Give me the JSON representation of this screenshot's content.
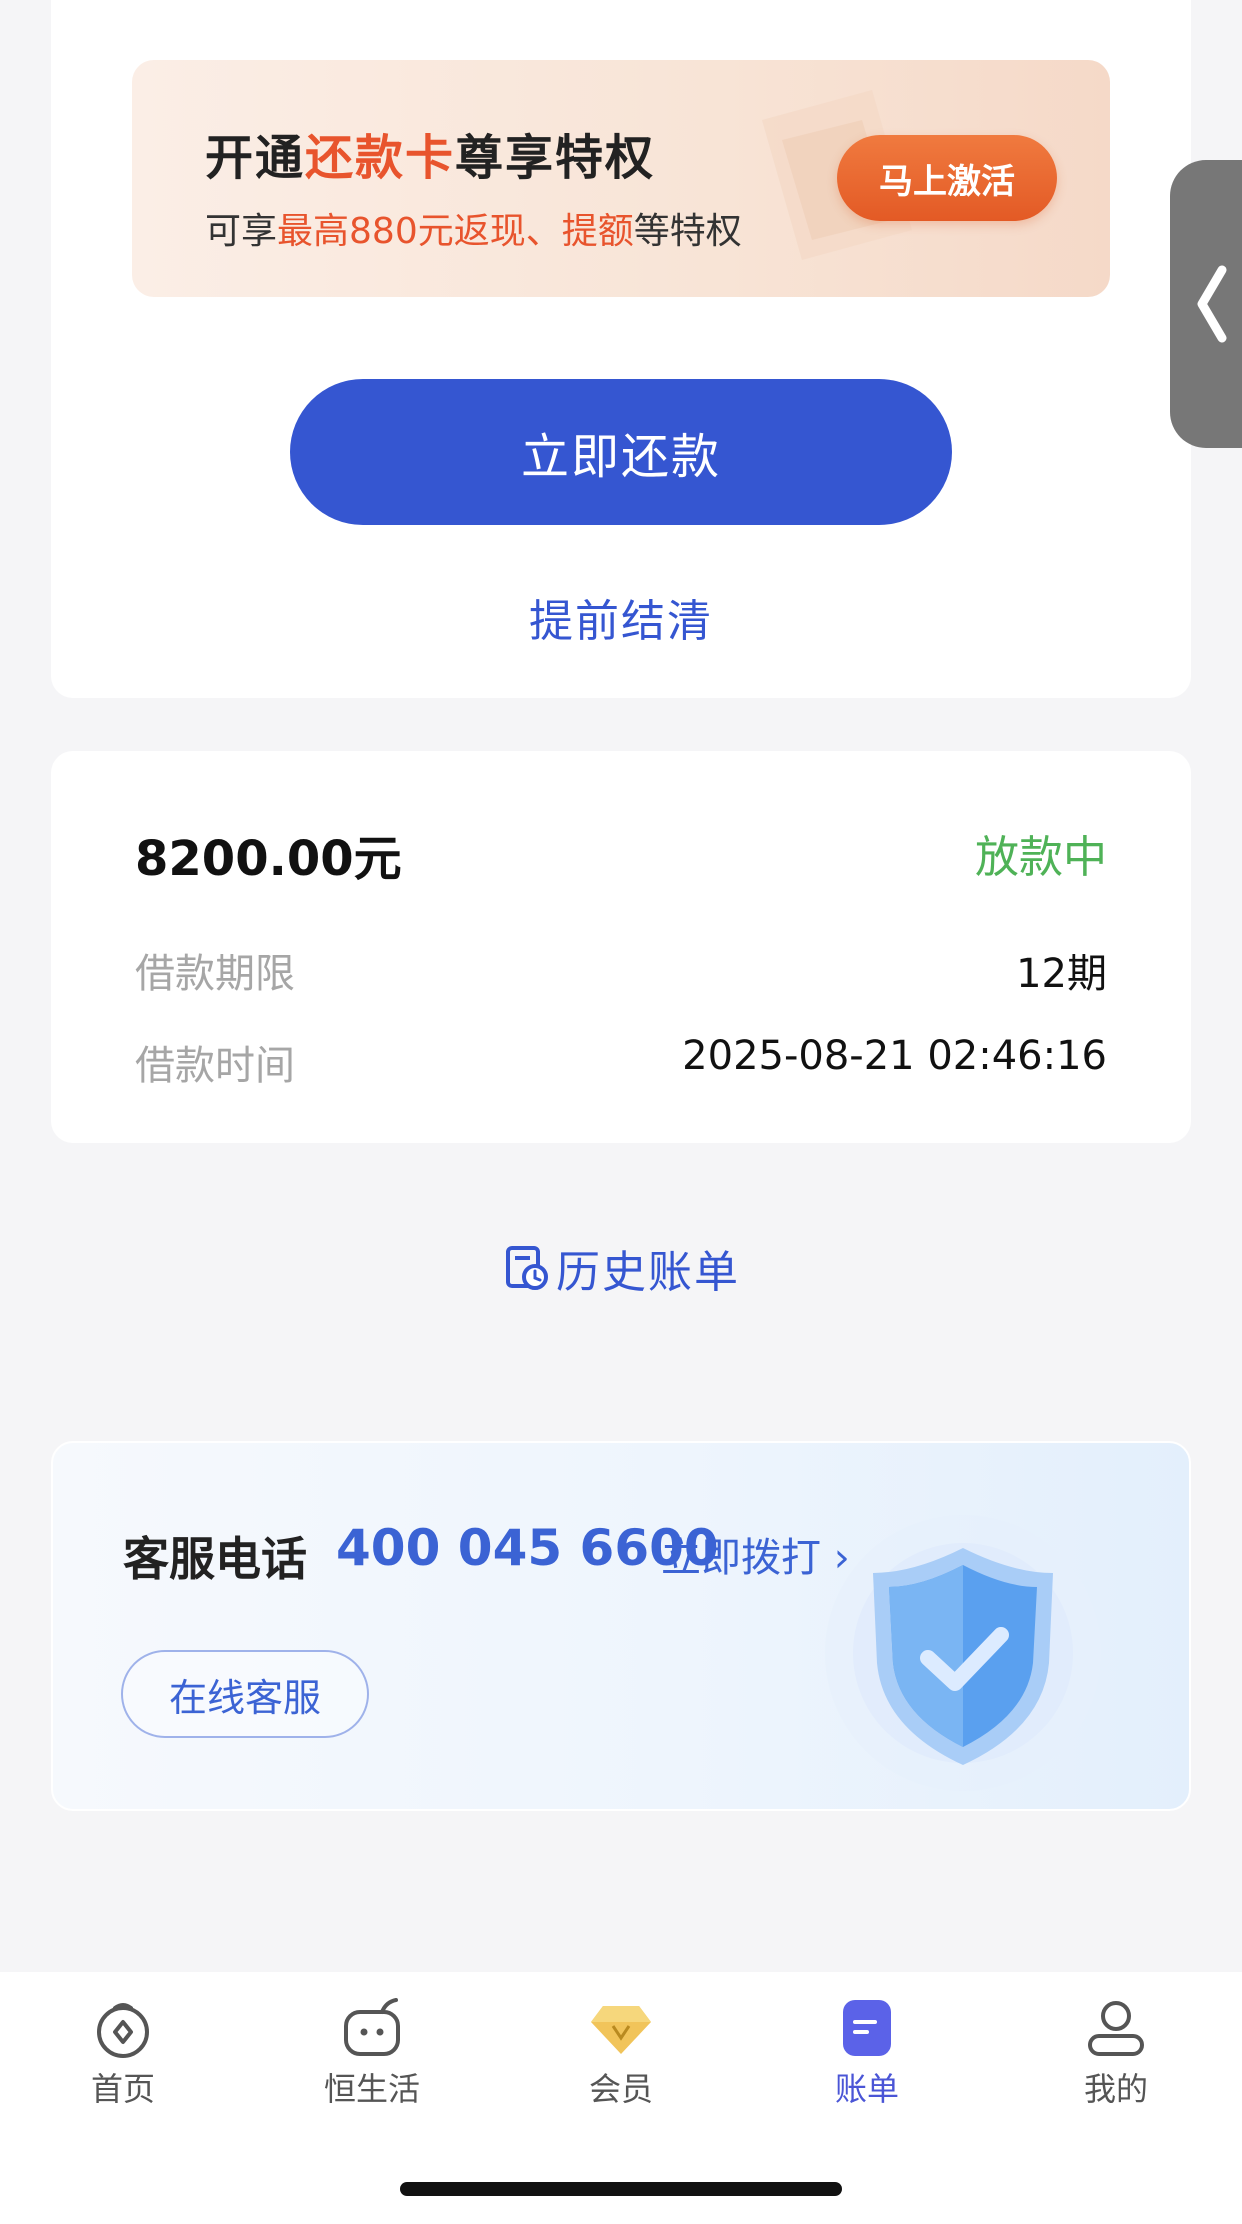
{
  "promo": {
    "title_pre": "开通",
    "title_hl": "还款卡",
    "title_post": "尊享特权",
    "sub_pre": "可享",
    "sub_hl1": "最高880元返现、提额",
    "sub_post": "等特权",
    "activate_label": "马上激活",
    "accent_color": "#e8542d"
  },
  "actions": {
    "repay_label": "立即还款",
    "settle_label": "提前结清",
    "accent_color": "#3556d1"
  },
  "loan": {
    "amount": "8200.00元",
    "status": "放款中",
    "status_color": "#4fb257",
    "rows": [
      {
        "label": "借款期限",
        "value": "12期"
      },
      {
        "label": "借款时间",
        "value": "2025-08-21 02:46:16"
      }
    ]
  },
  "history": {
    "label": "历史账单",
    "icon": "bill-history-icon"
  },
  "service": {
    "title": "客服电话",
    "phone": "400 045 6600",
    "dial_label": "立即拨打 ›",
    "online_label": "在线客服",
    "icon": "shield-check-icon"
  },
  "nav": {
    "items": [
      {
        "label": "首页",
        "icon": "home-icon"
      },
      {
        "label": "恒生活",
        "icon": "life-icon"
      },
      {
        "label": "会员",
        "icon": "diamond-icon"
      },
      {
        "label": "账单",
        "icon": "bill-icon",
        "active": true
      },
      {
        "label": "我的",
        "icon": "user-icon"
      }
    ],
    "active_color": "#4a55d6"
  }
}
